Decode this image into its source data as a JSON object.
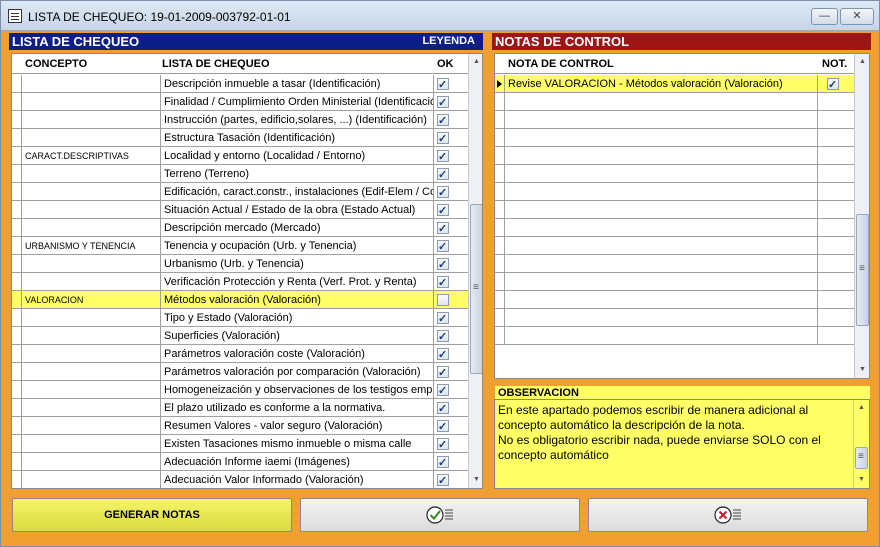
{
  "window": {
    "title": "LISTA DE CHEQUEO: 19-01-2009-003792-01-01",
    "min_glyph": "—",
    "close_glyph": "✕"
  },
  "left_panel": {
    "title": "LISTA DE CHEQUEO",
    "legend_link": "LEYENDA",
    "columns": {
      "concepto": "CONCEPTO",
      "lista": "LISTA DE CHEQUEO",
      "ok": "OK"
    },
    "rows": [
      {
        "concepto": "",
        "item": "Descripción inmueble a tasar (Identificación)",
        "ok": true,
        "highlight": false
      },
      {
        "concepto": "",
        "item": "Finalidad / Cumplimiento Orden Ministerial (Identificación)",
        "ok": true,
        "highlight": false
      },
      {
        "concepto": "",
        "item": "Instrucción (partes, edificio,solares, ...) (Identificación)",
        "ok": true,
        "highlight": false
      },
      {
        "concepto": "",
        "item": "Estructura Tasación (Identificación)",
        "ok": true,
        "highlight": false
      },
      {
        "concepto": "CARACT.DESCRIPTIVAS",
        "item": "Localidad y entorno (Localidad / Entorno)",
        "ok": true,
        "highlight": false
      },
      {
        "concepto": "",
        "item": "Terreno (Terreno)",
        "ok": true,
        "highlight": false
      },
      {
        "concepto": "",
        "item": "Edificación, caract.constr., instalaciones (Edif-Elem / Coor",
        "ok": true,
        "highlight": false
      },
      {
        "concepto": "",
        "item": "Situación Actual / Estado de la obra (Estado Actual)",
        "ok": true,
        "highlight": false
      },
      {
        "concepto": "",
        "item": "Descripción mercado (Mercado)",
        "ok": true,
        "highlight": false
      },
      {
        "concepto": "URBANISMO Y TENENCIA",
        "item": "Tenencia y ocupación (Urb. y Tenencia)",
        "ok": true,
        "highlight": false
      },
      {
        "concepto": "",
        "item": "Urbanismo (Urb. y Tenencia)",
        "ok": true,
        "highlight": false
      },
      {
        "concepto": "",
        "item": "Verificación Protección y Renta (Verf. Prot. y Renta)",
        "ok": true,
        "highlight": false
      },
      {
        "concepto": "VALORACION",
        "item": "Métodos valoración (Valoración)",
        "ok": false,
        "highlight": true
      },
      {
        "concepto": "",
        "item": "Tipo y Estado (Valoración)",
        "ok": true,
        "highlight": false
      },
      {
        "concepto": "",
        "item": "Superficies (Valoración)",
        "ok": true,
        "highlight": false
      },
      {
        "concepto": "",
        "item": "Parámetros valoración coste (Valoración)",
        "ok": true,
        "highlight": false
      },
      {
        "concepto": "",
        "item": "Parámetros valoración por comparación (Valoración)",
        "ok": true,
        "highlight": false
      },
      {
        "concepto": "",
        "item": "Homogeneización y observaciones de los testigos emplea",
        "ok": true,
        "highlight": false
      },
      {
        "concepto": "",
        "item": "El plazo utilizado es conforme a la normativa.",
        "ok": true,
        "highlight": false
      },
      {
        "concepto": "",
        "item": "Resumen Valores - valor seguro (Valoración)",
        "ok": true,
        "highlight": false
      },
      {
        "concepto": "",
        "item": "Existen Tasaciones mismo inmueble o misma calle",
        "ok": true,
        "highlight": false
      },
      {
        "concepto": "",
        "item": "Adecuación Informe iaemi (Imágenes)",
        "ok": true,
        "highlight": false
      },
      {
        "concepto": "",
        "item": "Adecuación Valor Informado (Valoración)",
        "ok": true,
        "highlight": false
      }
    ]
  },
  "right_panel": {
    "title": "NOTAS DE CONTROL",
    "columns": {
      "nota": "NOTA DE CONTROL",
      "not": "NOT."
    },
    "rows": [
      {
        "nota": "Revise VALORACION - Métodos valoración (Valoración)",
        "not": true
      }
    ],
    "empty_rows": 14
  },
  "observacion": {
    "label": "OBSERVACION",
    "text": "En este apartado podemos escribir de manera adicional al concepto automático la descripción de la nota.\nNo es obligatorio escribir nada, puede enviarse SOLO con el concepto automático"
  },
  "buttons": {
    "generar": "GENERAR NOTAS"
  },
  "colors": {
    "frame": "#f0a030",
    "left_header": "#0c1f86",
    "right_header": "#9c1616",
    "highlight": "#ffff66"
  }
}
